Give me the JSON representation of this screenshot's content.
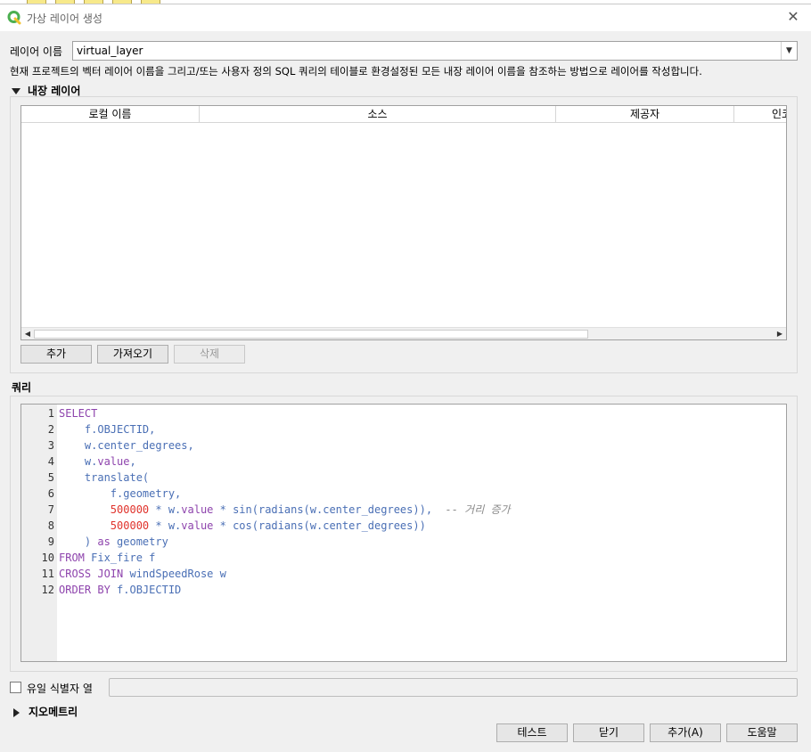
{
  "window": {
    "title": "가상 레이어 생성",
    "close_label": "✕"
  },
  "layer_name": {
    "label": "레이어 이름",
    "value": "virtual_layer"
  },
  "description": "현재 프로젝트의 벡터 레이어 이름을 그리고/또는 사용자 정의 SQL 쿼리의 테이블로 환경설정된 모든 내장 레이어 이름을 참조하는 방법으로 레이어를 작성합니다.",
  "embedded": {
    "header": "내장 레이어",
    "columns": [
      "로컬 이름",
      "소스",
      "제공자",
      "인코"
    ],
    "buttons": {
      "add": "추가",
      "import": "가져오기",
      "delete": "삭제"
    }
  },
  "query": {
    "header": "쿼리",
    "line_numbers": [
      "1",
      "2",
      "3",
      "4",
      "5",
      "6",
      "7",
      "8",
      "9",
      "10",
      "11",
      "12"
    ]
  },
  "unique_id": {
    "label": "유일 식별자 열"
  },
  "geometry": {
    "header": "지오메트리"
  },
  "footer": {
    "test": "테스트",
    "close": "닫기",
    "add": "추가(A)",
    "help": "도움말"
  },
  "colors": {
    "keyword": "#8e44ad",
    "identifier": "#4a6fb5",
    "number": "#e0322b",
    "comment": "#8a8a8a"
  }
}
